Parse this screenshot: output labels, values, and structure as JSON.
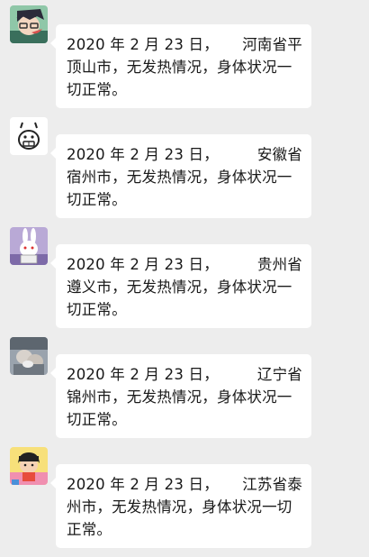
{
  "messages": [
    {
      "avatar_icon": "anime-character-avatar-icon",
      "date_text": "2020 年 2 月 23 日，",
      "place_head": "河南省平",
      "line2": "顶山市，无发热情况，身体状况一",
      "line3": "切正常。"
    },
    {
      "avatar_icon": "cartoon-face-avatar-icon",
      "date_text": "2020 年 2 月 23 日，",
      "place_head": "安徽省",
      "line2": "宿州市，无发热情况，身体状况一",
      "line3": "切正常。"
    },
    {
      "avatar_icon": "rabbit-character-avatar-icon",
      "date_text": "2020 年 2 月 23 日，",
      "place_head": "贵州省",
      "line2": "遵义市，无发热情况，身体状况一",
      "line3": "切正常。"
    },
    {
      "avatar_icon": "photo-avatar-icon",
      "date_text": "2020 年 2 月 23 日，",
      "place_head": "辽宁省",
      "line2": "锦州市，无发热情况，身体状况一",
      "line3": "切正常。"
    },
    {
      "avatar_icon": "cartoon-girl-avatar-icon",
      "date_text": "2020 年 2 月 23 日，",
      "place_head": "江苏省泰",
      "line2": "州市，无发热情况，身体状况一切",
      "line3": "正常。"
    }
  ],
  "colors": {
    "background": "#ededed",
    "bubble": "#ffffff",
    "text": "#191919"
  }
}
